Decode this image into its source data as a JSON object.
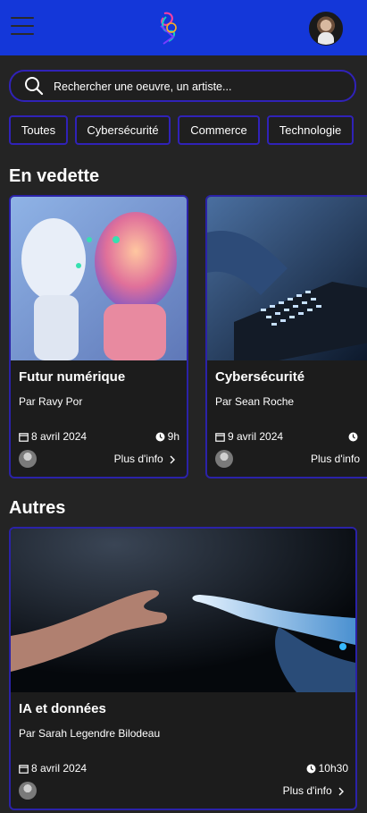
{
  "search": {
    "placeholder": "Rechercher une oeuvre, un artiste..."
  },
  "chips": [
    "Toutes",
    "Cybersécurité",
    "Commerce",
    "Technologie"
  ],
  "sections": {
    "featured": "En vedette",
    "others": "Autres"
  },
  "featured": [
    {
      "title": "Futur numérique",
      "author": "Par Ravy Por",
      "date": "8 avril 2024",
      "duration": "9h",
      "more": "Plus d'info"
    },
    {
      "title": "Cybersécurité",
      "author": "Par Sean Roche",
      "date": "9 avril 2024",
      "duration": "",
      "more": "Plus d'info"
    }
  ],
  "others": [
    {
      "title": "IA et données",
      "author": "Par Sarah Legendre Bilodeau",
      "date": "8 avril 2024",
      "duration": "10h30",
      "more": "Plus d'info"
    }
  ],
  "colors": {
    "header": "#1437d9",
    "accent_border": "#3022b8",
    "background": "#242424"
  }
}
